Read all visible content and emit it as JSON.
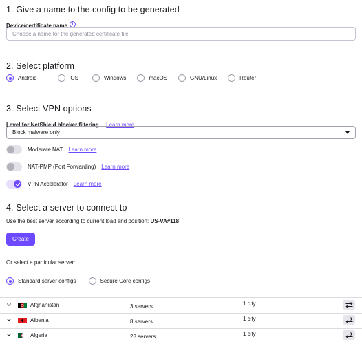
{
  "section1": {
    "title": "1. Give a name to the config to be generated",
    "field_label": "Device/certificate name",
    "info_icon": "info-icon",
    "placeholder": "Choose a name for the generated certificate file"
  },
  "section2": {
    "title": "2. Select platform",
    "options": [
      "Android",
      "iOS",
      "Windows",
      "macOS",
      "GNU/Linux",
      "Router"
    ],
    "selected": "Android"
  },
  "section3": {
    "title": "3. Select VPN options",
    "netshield_label": "Level for NetShield blocker filtering",
    "learn_more": "Learn more",
    "netshield_value": "Block malware only",
    "toggles": [
      {
        "label": "Moderate NAT",
        "on": false,
        "link": "Learn more"
      },
      {
        "label": "NAT-PMP (Port Forwarding)",
        "on": false,
        "link": "Learn more"
      },
      {
        "label": "VPN Accelerator",
        "on": true,
        "link": "Learn more"
      }
    ]
  },
  "section4": {
    "title": "4. Select a server to connect to",
    "best_server_text": "Use the best server according to current load and position:",
    "best_server": "US-VA#118",
    "create_label": "Create",
    "or_select": "Or select a particular server:",
    "config_options": [
      "Standard server configs",
      "Secure Core configs"
    ],
    "config_selected": "Standard server configs",
    "rows": [
      {
        "country": "Afghanistan",
        "servers": "3 servers",
        "cities": "1 city",
        "flag": "af"
      },
      {
        "country": "Albania",
        "servers": "8 servers",
        "cities": "1 city",
        "flag": "al"
      },
      {
        "country": "Algeria",
        "servers": "28 servers",
        "cities": "1 city",
        "flag": "dz"
      }
    ]
  },
  "colors": {
    "accent": "#6d4aff",
    "text": "#1b1b1f",
    "border": "#c5c3cf"
  }
}
